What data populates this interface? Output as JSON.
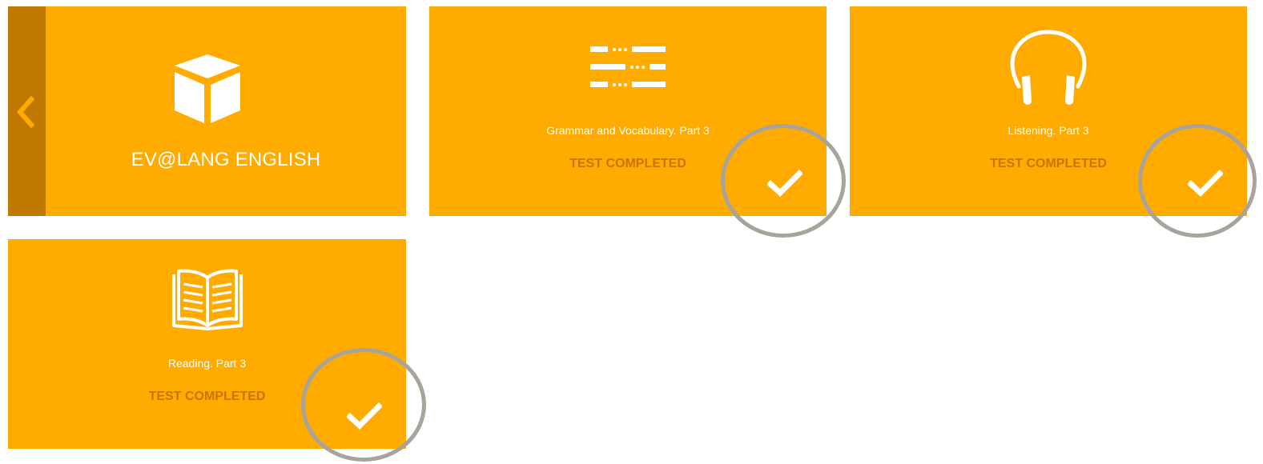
{
  "main_tile": {
    "title": "EV@LANG ENGLISH",
    "back_icon": "chevron-left-icon",
    "icon": "cube-icon"
  },
  "tests": [
    {
      "label": "Grammar and Vocabulary. Part 3",
      "status": "TEST COMPLETED",
      "icon": "fill-in-blanks-icon",
      "status_icon": "checkmark-icon"
    },
    {
      "label": "Listening. Part 3",
      "status": "TEST COMPLETED",
      "icon": "headphones-icon",
      "status_icon": "checkmark-icon"
    },
    {
      "label": "Reading. Part 3",
      "status": "TEST COMPLETED",
      "icon": "open-book-icon",
      "status_icon": "checkmark-icon"
    }
  ],
  "colors": {
    "tile": "#FFAB00",
    "back_strip": "#C07800",
    "status_text": "#C87500",
    "highlight_ring": "#A8A39B"
  }
}
